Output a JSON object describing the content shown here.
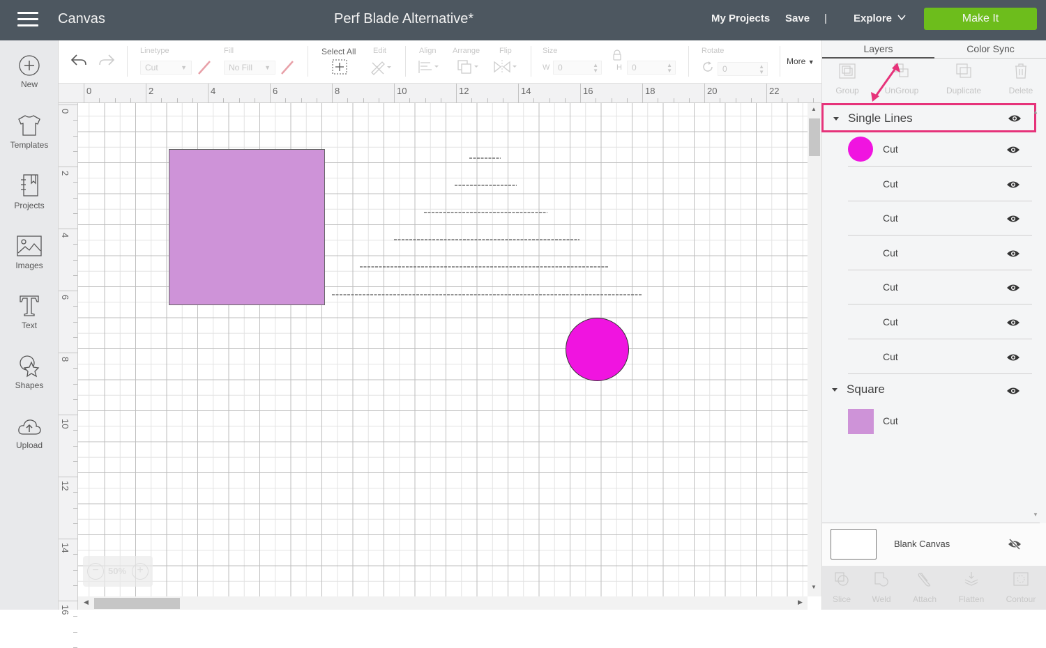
{
  "header": {
    "app_title": "Canvas",
    "document_title": "Perf Blade Alternative*",
    "my_projects": "My Projects",
    "save": "Save",
    "separator": "|",
    "explore": "Explore",
    "make_it": "Make It"
  },
  "sidebar": {
    "items": [
      {
        "label": "New",
        "icon": "plus-circle-icon"
      },
      {
        "label": "Templates",
        "icon": "tshirt-icon"
      },
      {
        "label": "Projects",
        "icon": "notebook-icon"
      },
      {
        "label": "Images",
        "icon": "image-icon"
      },
      {
        "label": "Text",
        "icon": "text-t-icon"
      },
      {
        "label": "Shapes",
        "icon": "shapes-icon"
      },
      {
        "label": "Upload",
        "icon": "cloud-upload-icon"
      }
    ]
  },
  "toolbar": {
    "linetype_label": "Linetype",
    "linetype_value": "Cut",
    "fill_label": "Fill",
    "fill_value": "No Fill",
    "select_all": "Select All",
    "edit": "Edit",
    "align": "Align",
    "arrange": "Arrange",
    "flip": "Flip",
    "size": "Size",
    "w_label": "W",
    "w_value": "0",
    "h_label": "H",
    "h_value": "0",
    "rotate": "Rotate",
    "rotate_value": "0",
    "more": "More"
  },
  "rulers": {
    "top": [
      "0",
      "2",
      "4",
      "6",
      "8",
      "10",
      "12",
      "14",
      "16",
      "18",
      "20",
      "22"
    ],
    "left": [
      "0",
      "2",
      "4",
      "6",
      "8",
      "10",
      "12",
      "14",
      "16"
    ]
  },
  "zoom_control": {
    "value": "50%"
  },
  "canvas_objects": {
    "square_color": "#ce93d8",
    "circle_color": "#f014e0",
    "dashed_lines": 6
  },
  "panel": {
    "tabs": [
      "Layers",
      "Color Sync"
    ],
    "active_tab": "Layers",
    "tools": [
      "Group",
      "UnGroup",
      "Duplicate",
      "Delete"
    ],
    "groups": [
      {
        "name": "Single Lines",
        "highlighted": true,
        "layers": [
          {
            "label": "Cut",
            "swatch": "circle",
            "color": "#f014e0"
          },
          {
            "label": "Cut"
          },
          {
            "label": "Cut"
          },
          {
            "label": "Cut"
          },
          {
            "label": "Cut"
          },
          {
            "label": "Cut"
          },
          {
            "label": "Cut"
          }
        ]
      },
      {
        "name": "Square",
        "layers": [
          {
            "label": "Cut",
            "swatch": "square",
            "color": "#ce93d8"
          }
        ]
      }
    ],
    "blank_canvas": "Blank Canvas",
    "bottom_tools": [
      "Slice",
      "Weld",
      "Attach",
      "Flatten",
      "Contour"
    ]
  },
  "colors": {
    "header_bg": "#4d5760",
    "make_it": "#6dbd1c",
    "highlight": "#e6337a"
  }
}
